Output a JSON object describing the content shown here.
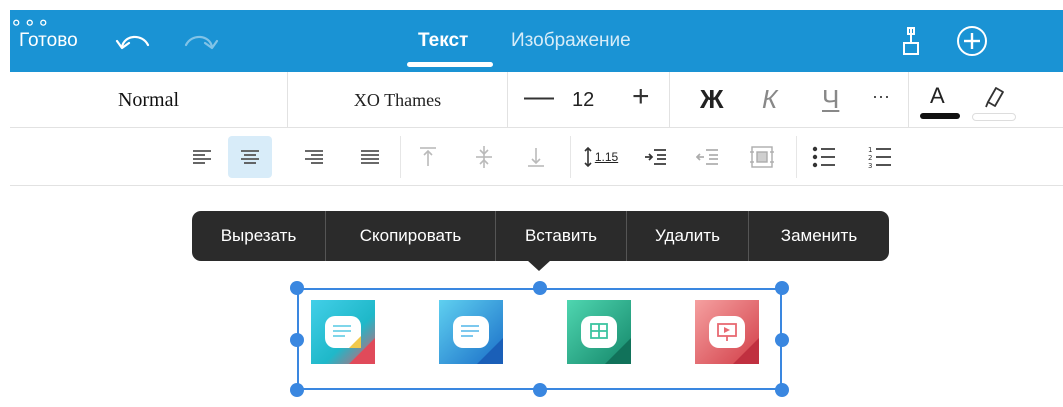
{
  "topbar": {
    "done_label": "Готово",
    "tabs": [
      {
        "label": "Текст",
        "active": true
      },
      {
        "label": "Изображение",
        "active": false
      }
    ],
    "more_label": "∘∘∘",
    "accent_color": "#1a93d4"
  },
  "format": {
    "style": "Normal",
    "font": "XO Thames",
    "size": "12",
    "minus_label": "—",
    "plus_label": "+",
    "bold_label": "Ж",
    "italic_label": "К",
    "underline_label": "Ч",
    "more_label": "···",
    "font_color_label": "A",
    "font_color_value": "#111111"
  },
  "paragraph": {
    "line_spacing_label": "1.15",
    "active_alignment": "center"
  },
  "context_menu": {
    "items": [
      "Вырезать",
      "Скопировать",
      "Вставить",
      "Удалить",
      "Заменить"
    ]
  },
  "selected_icons": [
    {
      "name": "document-app-icon",
      "colors": [
        "#38c5e8",
        "#f0c040",
        "#e84a5f"
      ]
    },
    {
      "name": "text-app-icon",
      "colors": [
        "#48b8e8",
        "#1a6fc8"
      ]
    },
    {
      "name": "spreadsheet-app-icon",
      "colors": [
        "#3cc8a0",
        "#1a8a6a"
      ]
    },
    {
      "name": "presentation-app-icon",
      "colors": [
        "#f08a8a",
        "#d84a4a"
      ]
    }
  ]
}
